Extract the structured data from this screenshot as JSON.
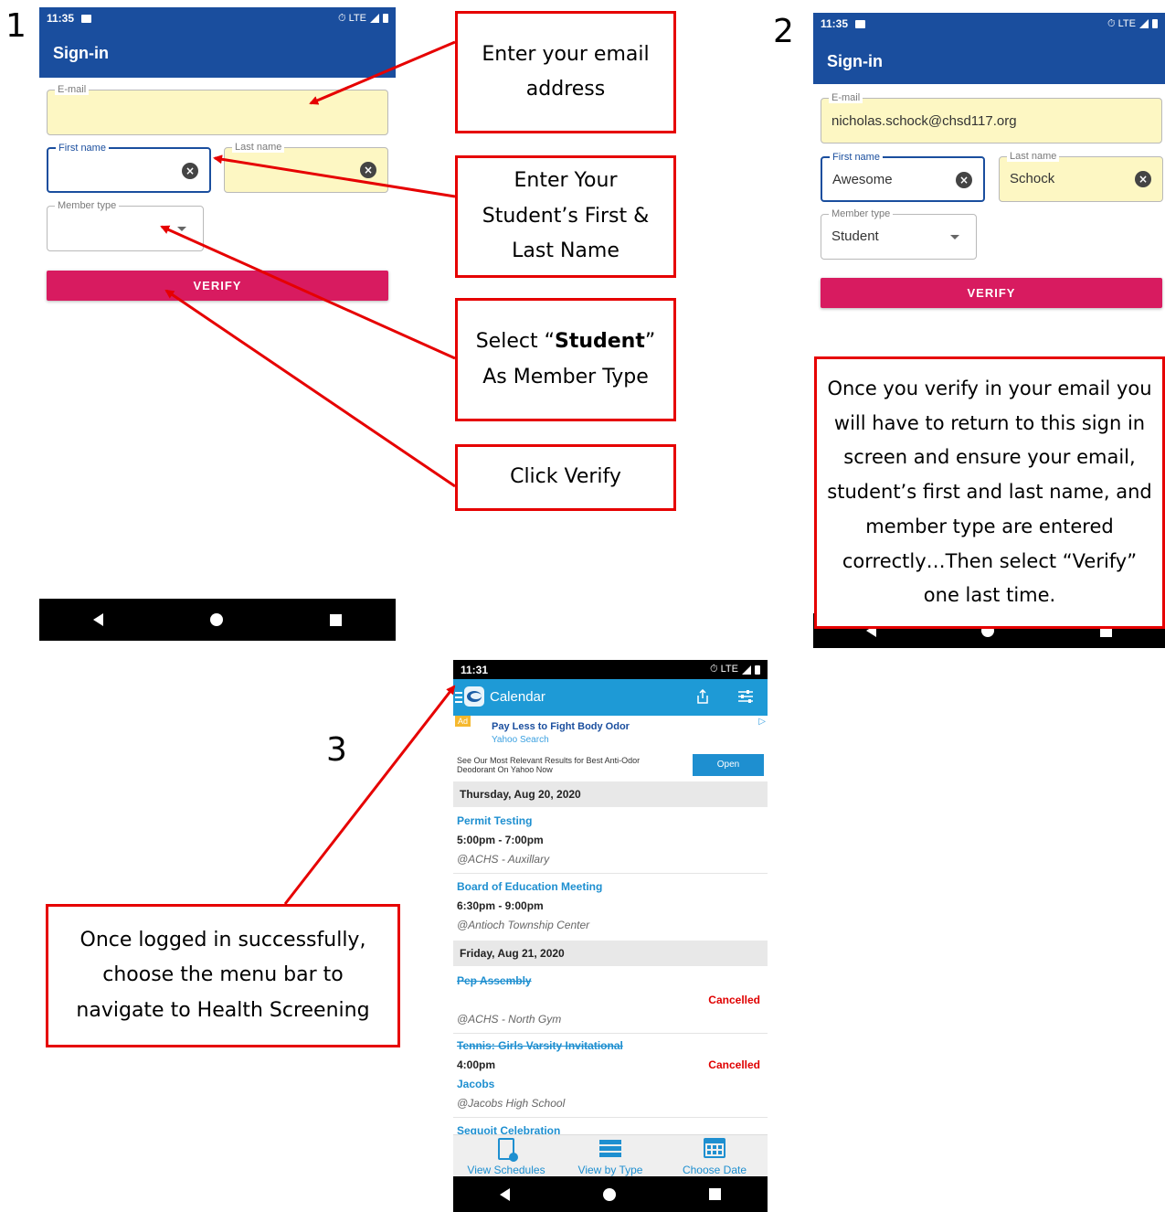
{
  "steps": {
    "one": "1",
    "two": "2",
    "three": "3"
  },
  "phone1": {
    "status_time": "11:35",
    "status_right": "⏱ LTE",
    "title": "Sign-in",
    "email_label": "E-mail",
    "email_value": "",
    "first_label": "First name",
    "first_value": "",
    "last_label": "Last name",
    "last_value": "",
    "member_label": "Member type",
    "member_value": "",
    "verify": "VERIFY"
  },
  "phone2": {
    "status_time": "11:35",
    "status_right": "⏱ LTE",
    "title": "Sign-in",
    "email_label": "E-mail",
    "email_value": "nicholas.schock@chsd117.org",
    "first_label": "First name",
    "first_value": "Awesome",
    "last_label": "Last name",
    "last_value": "Schock",
    "member_label": "Member type",
    "member_value": "Student",
    "verify": "VERIFY"
  },
  "callouts": {
    "email": "Enter your email address",
    "name": "Enter Your Student’s First & Last Name",
    "member_pre": "Select “",
    "member_bold": "Student",
    "member_post": "” As Member Type",
    "verify": "Click Verify",
    "final": "Once you verify in your email you will have to return to this sign in screen and ensure your email, student’s first and last name, and member type are entered correctly…Then select “Verify” one last time.",
    "menu": "Once logged in successfully, choose the menu bar to navigate to Health Screening"
  },
  "calendar": {
    "status_time": "11:31",
    "status_right": "⏱ LTE",
    "title": "Calendar",
    "ad": {
      "badge": "Ad",
      "headline": "Pay Less to Fight Body Odor",
      "source": "Yahoo Search",
      "body": "See Our Most Relevant Results for Best Anti-Odor Deodorant On Yahoo Now",
      "button": "Open"
    },
    "dates": [
      "Thursday, Aug 20, 2020",
      "Friday, Aug 21, 2020"
    ],
    "events": [
      {
        "title": "Permit Testing",
        "time": "5:00pm - 7:00pm",
        "location": "@ACHS - Auxillary"
      },
      {
        "title": "Board of Education Meeting",
        "time": "6:30pm - 9:00pm",
        "location": "@Antioch Township Center"
      },
      {
        "title": "Pep Assembly",
        "status": "Cancelled",
        "location": "@ACHS - North Gym"
      },
      {
        "title": "Tennis: Girls Varsity  Invitational",
        "time": "4:00pm",
        "status": "Cancelled",
        "opponent": "Jacobs",
        "location": "@Jacobs High School"
      },
      {
        "title": "Sequoit Celebration"
      }
    ],
    "tabs": [
      "View Schedules",
      "View by Type",
      "Choose Date"
    ]
  },
  "colors": {
    "appbar_blue": "#1a4e9e",
    "calendar_blue": "#1e9ad6",
    "verify_pink": "#d81b60",
    "callout_red": "#e60000"
  }
}
